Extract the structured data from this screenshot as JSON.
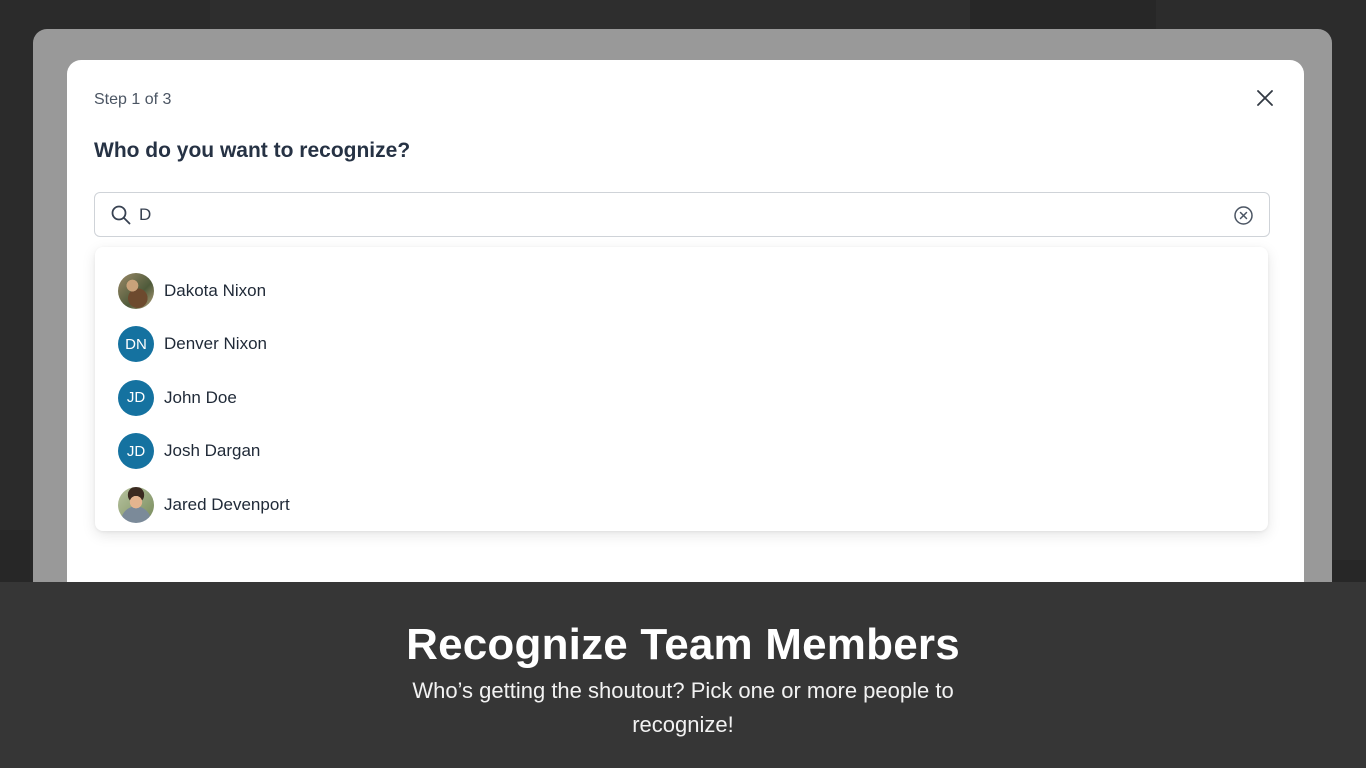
{
  "modal": {
    "step_label": "Step 1 of 3",
    "heading": "Who do you want to recognize?",
    "search": {
      "value": "D",
      "placeholder": ""
    },
    "results": [
      {
        "name": "Dakota Nixon",
        "avatar_type": "photo",
        "initials": ""
      },
      {
        "name": "Denver Nixon",
        "avatar_type": "initials",
        "initials": "DN"
      },
      {
        "name": "John Doe",
        "avatar_type": "initials",
        "initials": "JD"
      },
      {
        "name": "Josh Dargan",
        "avatar_type": "initials",
        "initials": "JD"
      },
      {
        "name": "Jared Devenport",
        "avatar_type": "photo",
        "initials": ""
      }
    ]
  },
  "caption": {
    "title": "Recognize Team Members",
    "subtitle": "Who’s getting the shoutout? Pick one or more people to recognize!"
  },
  "icons": {
    "close": "close-icon",
    "search": "search-icon",
    "clear": "clear-circle-x-icon"
  },
  "colors": {
    "avatar_initials_bg": "#1572a0",
    "heading_text": "#263244",
    "caption_bg": "#363636"
  }
}
